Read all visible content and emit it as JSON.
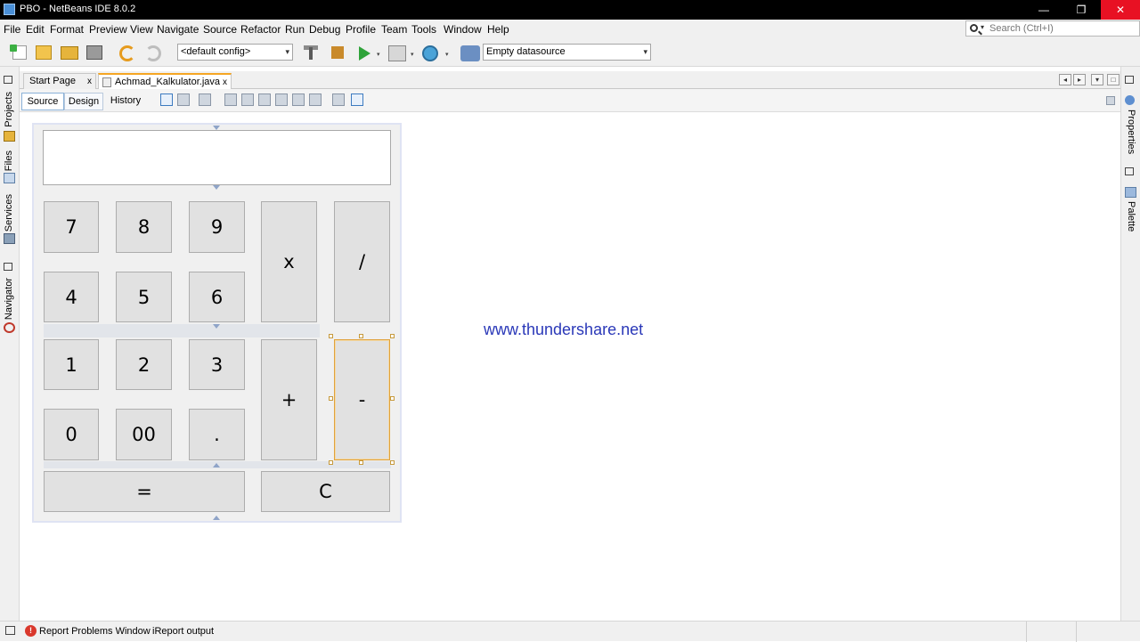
{
  "window": {
    "title": "PBO - NetBeans IDE 8.0.2",
    "controls": {
      "minimize": "—",
      "maximize": "❐",
      "close": "✕"
    }
  },
  "menu": [
    "File",
    "Edit",
    "Format",
    "Preview",
    "View",
    "Navigate",
    "Source",
    "Refactor",
    "Run",
    "Debug",
    "Profile",
    "Team",
    "Tools",
    "Window",
    "Help"
  ],
  "search": {
    "placeholder": "Search (Ctrl+I)"
  },
  "toolbar": {
    "config": "<default config>",
    "datasource": "Empty datasource",
    "icons": [
      "new-file-icon",
      "new-project-icon",
      "open-project-icon",
      "save-all-icon",
      "undo-icon",
      "redo-icon",
      "build-icon",
      "clean-build-icon",
      "run-icon",
      "debug-icon",
      "profile-icon",
      "datasource-icon"
    ]
  },
  "side_panels": {
    "left": [
      "Projects",
      "Files",
      "Services",
      "Navigator"
    ],
    "right": [
      "Properties",
      "Palette"
    ]
  },
  "editor_tabs": [
    {
      "label": "Start Page",
      "close": "x",
      "active": false
    },
    {
      "label": "Achmad_Kalkulator.java",
      "close": "x",
      "active": true
    }
  ],
  "view_tabs": {
    "source": "Source",
    "design": "Design",
    "history": "History",
    "selected": "Source"
  },
  "calculator": {
    "display_value": "",
    "buttons": [
      {
        "label": "7"
      },
      {
        "label": "8"
      },
      {
        "label": "9"
      },
      {
        "label": "x"
      },
      {
        "label": "/"
      },
      {
        "label": "4"
      },
      {
        "label": "5"
      },
      {
        "label": "6"
      },
      {
        "label": "1"
      },
      {
        "label": "2"
      },
      {
        "label": "3"
      },
      {
        "label": "+"
      },
      {
        "label": "-",
        "focused": true
      },
      {
        "label": "0"
      },
      {
        "label": "00"
      },
      {
        "label": "."
      },
      {
        "label": "="
      },
      {
        "label": "C"
      }
    ]
  },
  "watermark": "www.thundershare.net",
  "statusbar": {
    "problems": "Report Problems Window",
    "ireport": "iReport output"
  },
  "colors": {
    "accent_tab": "#f5a623",
    "watermark": "#2a38b8",
    "button_face": "#e1e1e1",
    "focus_border": "#e0a23b"
  }
}
